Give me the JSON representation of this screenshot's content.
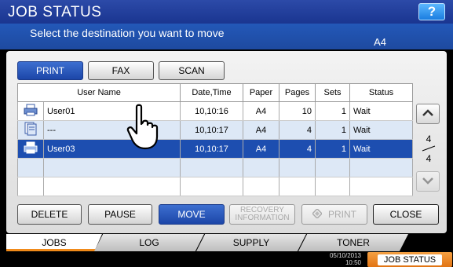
{
  "title": "JOB STATUS",
  "help_label": "?",
  "message": "Select the destination you want to move",
  "paper_size": "A4",
  "type_tabs": [
    "PRINT",
    "FAX",
    "SCAN"
  ],
  "table": {
    "headers": [
      "User Name",
      "Date,Time",
      "Paper",
      "Pages",
      "Sets",
      "Status"
    ],
    "rows": [
      {
        "user": "User01",
        "datetime": "10,10:16",
        "paper": "A4",
        "pages": "10",
        "sets": "1",
        "status": "Wait",
        "icon": "printer-icon"
      },
      {
        "user": "---",
        "datetime": "10,10:17",
        "paper": "A4",
        "pages": "4",
        "sets": "1",
        "status": "Wait",
        "icon": "document-icon"
      },
      {
        "user": "User03",
        "datetime": "10,10:17",
        "paper": "A4",
        "pages": "4",
        "sets": "1",
        "status": "Wait",
        "icon": "printer-icon"
      }
    ]
  },
  "pagination": {
    "current": "4",
    "total": "4"
  },
  "actions": {
    "delete": "DELETE",
    "pause": "PAUSE",
    "move": "MOVE",
    "recovery_line1": "RECOVERY",
    "recovery_line2": "INFORMATION",
    "print": "PRINT",
    "close": "CLOSE"
  },
  "bottom_tabs": [
    "JOBS",
    "LOG",
    "SUPPLY",
    "TONER"
  ],
  "footer": {
    "date": "05/10/2013",
    "time": "10:50",
    "job_status": "JOB STATUS"
  },
  "colors": {
    "accent": "#1d4eb0",
    "tab_underline": "#f08a1a",
    "footer_button": "#e27413"
  }
}
